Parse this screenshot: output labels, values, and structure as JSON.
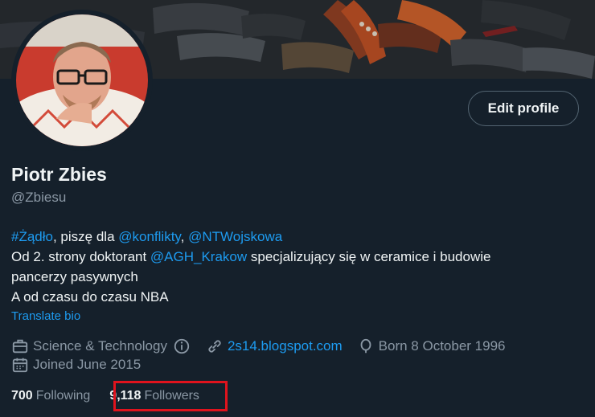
{
  "profile": {
    "name": "Piotr Zbies",
    "handle": "@Zbiesu",
    "edit_label": "Edit profile",
    "bio": {
      "line1": {
        "hashtag": "#Żądło",
        "text1": ", piszę dla ",
        "mention1": "@konflikty",
        "text2": ", ",
        "mention2": "@NTWojskowa"
      },
      "line2": {
        "text1": "Od 2. strony doktorant ",
        "mention": "@AGH_Krakow",
        "text2": " specjalizujący się w ceramice i budowie"
      },
      "line3": "pancerzy pasywnych",
      "line4": "A od czasu do czasu NBA"
    },
    "translate_label": "Translate bio",
    "category": "Science & Technology",
    "website": "2s14.blogspot.com",
    "birth": "Born 8 October 1996",
    "joined": "Joined June 2015",
    "following_count": "700",
    "following_label": "Following",
    "followers_count": "9,118",
    "followers_label": "Followers"
  },
  "colors": {
    "background": "#15202b",
    "link": "#1d9bf0",
    "muted": "#8b98a5",
    "highlight": "#e0131d"
  },
  "icons": [
    "professional-category-icon",
    "info-icon",
    "link-icon",
    "birthday-balloon-icon",
    "calendar-icon"
  ]
}
